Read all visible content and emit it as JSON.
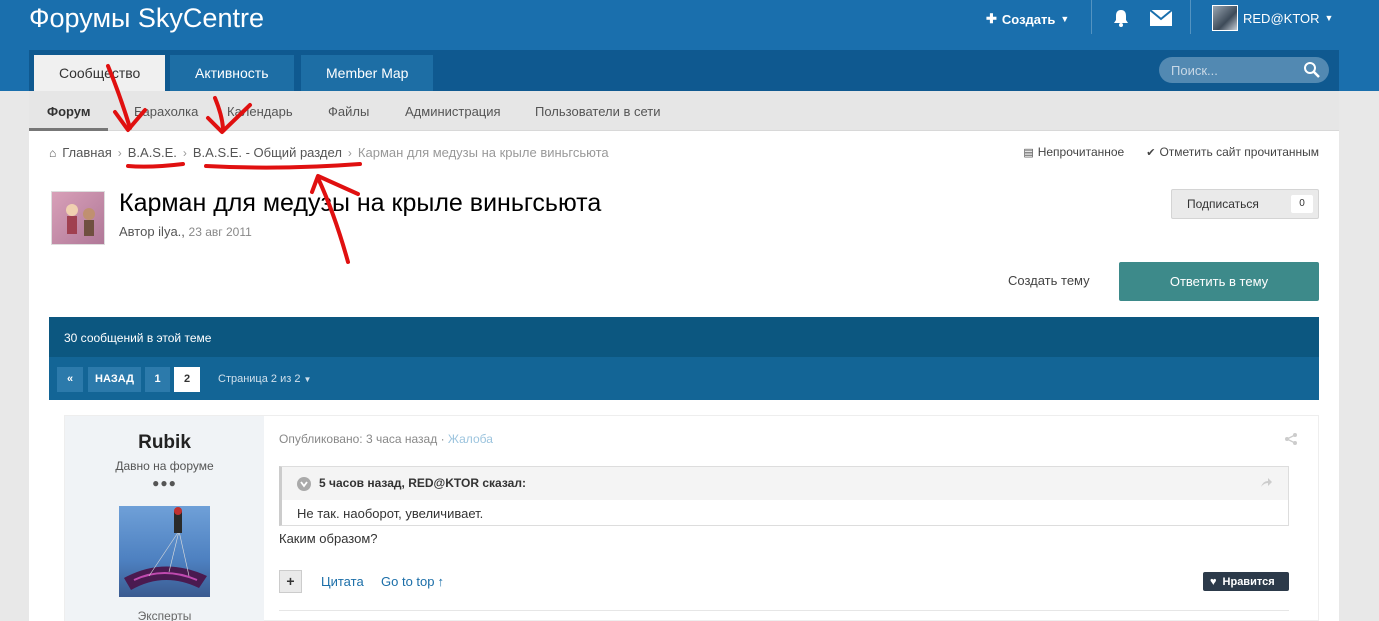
{
  "header": {
    "site_title": "Форумы SkyCentre",
    "create_label": "Создать",
    "username": "RED@KTOR"
  },
  "nav": {
    "tabs": [
      {
        "label": "Сообщество"
      },
      {
        "label": "Активность"
      },
      {
        "label": "Member Map"
      }
    ],
    "search_placeholder": "Поиск..."
  },
  "subnav": {
    "items": [
      {
        "label": "Форум"
      },
      {
        "label": "Барахолка"
      },
      {
        "label": "Календарь"
      },
      {
        "label": "Файлы"
      },
      {
        "label": "Администрация"
      },
      {
        "label": "Пользователи в сети"
      }
    ]
  },
  "breadcrumb": {
    "home": "Главная",
    "items": [
      "B.A.S.E.",
      "B.A.S.E. - Общий раздел",
      "Карман для медузы на крыле виньгсьюта"
    ],
    "unread": "Непрочитанное",
    "mark_read": "Отметить сайт прочитанным"
  },
  "topic": {
    "title": "Карман для медузы на крыле виньгсьюта",
    "author_prefix": "Автор ilya.,",
    "date": "23 авг 2011",
    "subscribe_label": "Подписаться",
    "subscribe_count": "0",
    "create_topic": "Создать тему",
    "reply_label": "Ответить в тему",
    "posts_count": "30 сообщений в этой теме"
  },
  "pagination": {
    "back": "НАЗАД",
    "pages": [
      "1",
      "2"
    ],
    "page_of": "Страница 2 из 2"
  },
  "post": {
    "author": "Rubik",
    "rank": "Давно на форуме",
    "rank_dots": "●●●",
    "group": "Эксперты",
    "published": "Опубликовано: 3 часа назад",
    "report": "Жалоба",
    "quote_header": "5 часов назад, RED@KTOR сказал:",
    "quote_text": "Не так. наоборот, увеличивает.",
    "text": "Каким образом?",
    "quote_link": "Цитата",
    "gotop_link": "Go to top",
    "like_label": "Нравится"
  },
  "colors": {
    "header_bg": "#1a6fad",
    "nav_bg": "#0f5990",
    "reply_btn": "#3d8a8a",
    "link": "#1b6ea8",
    "annotation": "#e01010"
  }
}
